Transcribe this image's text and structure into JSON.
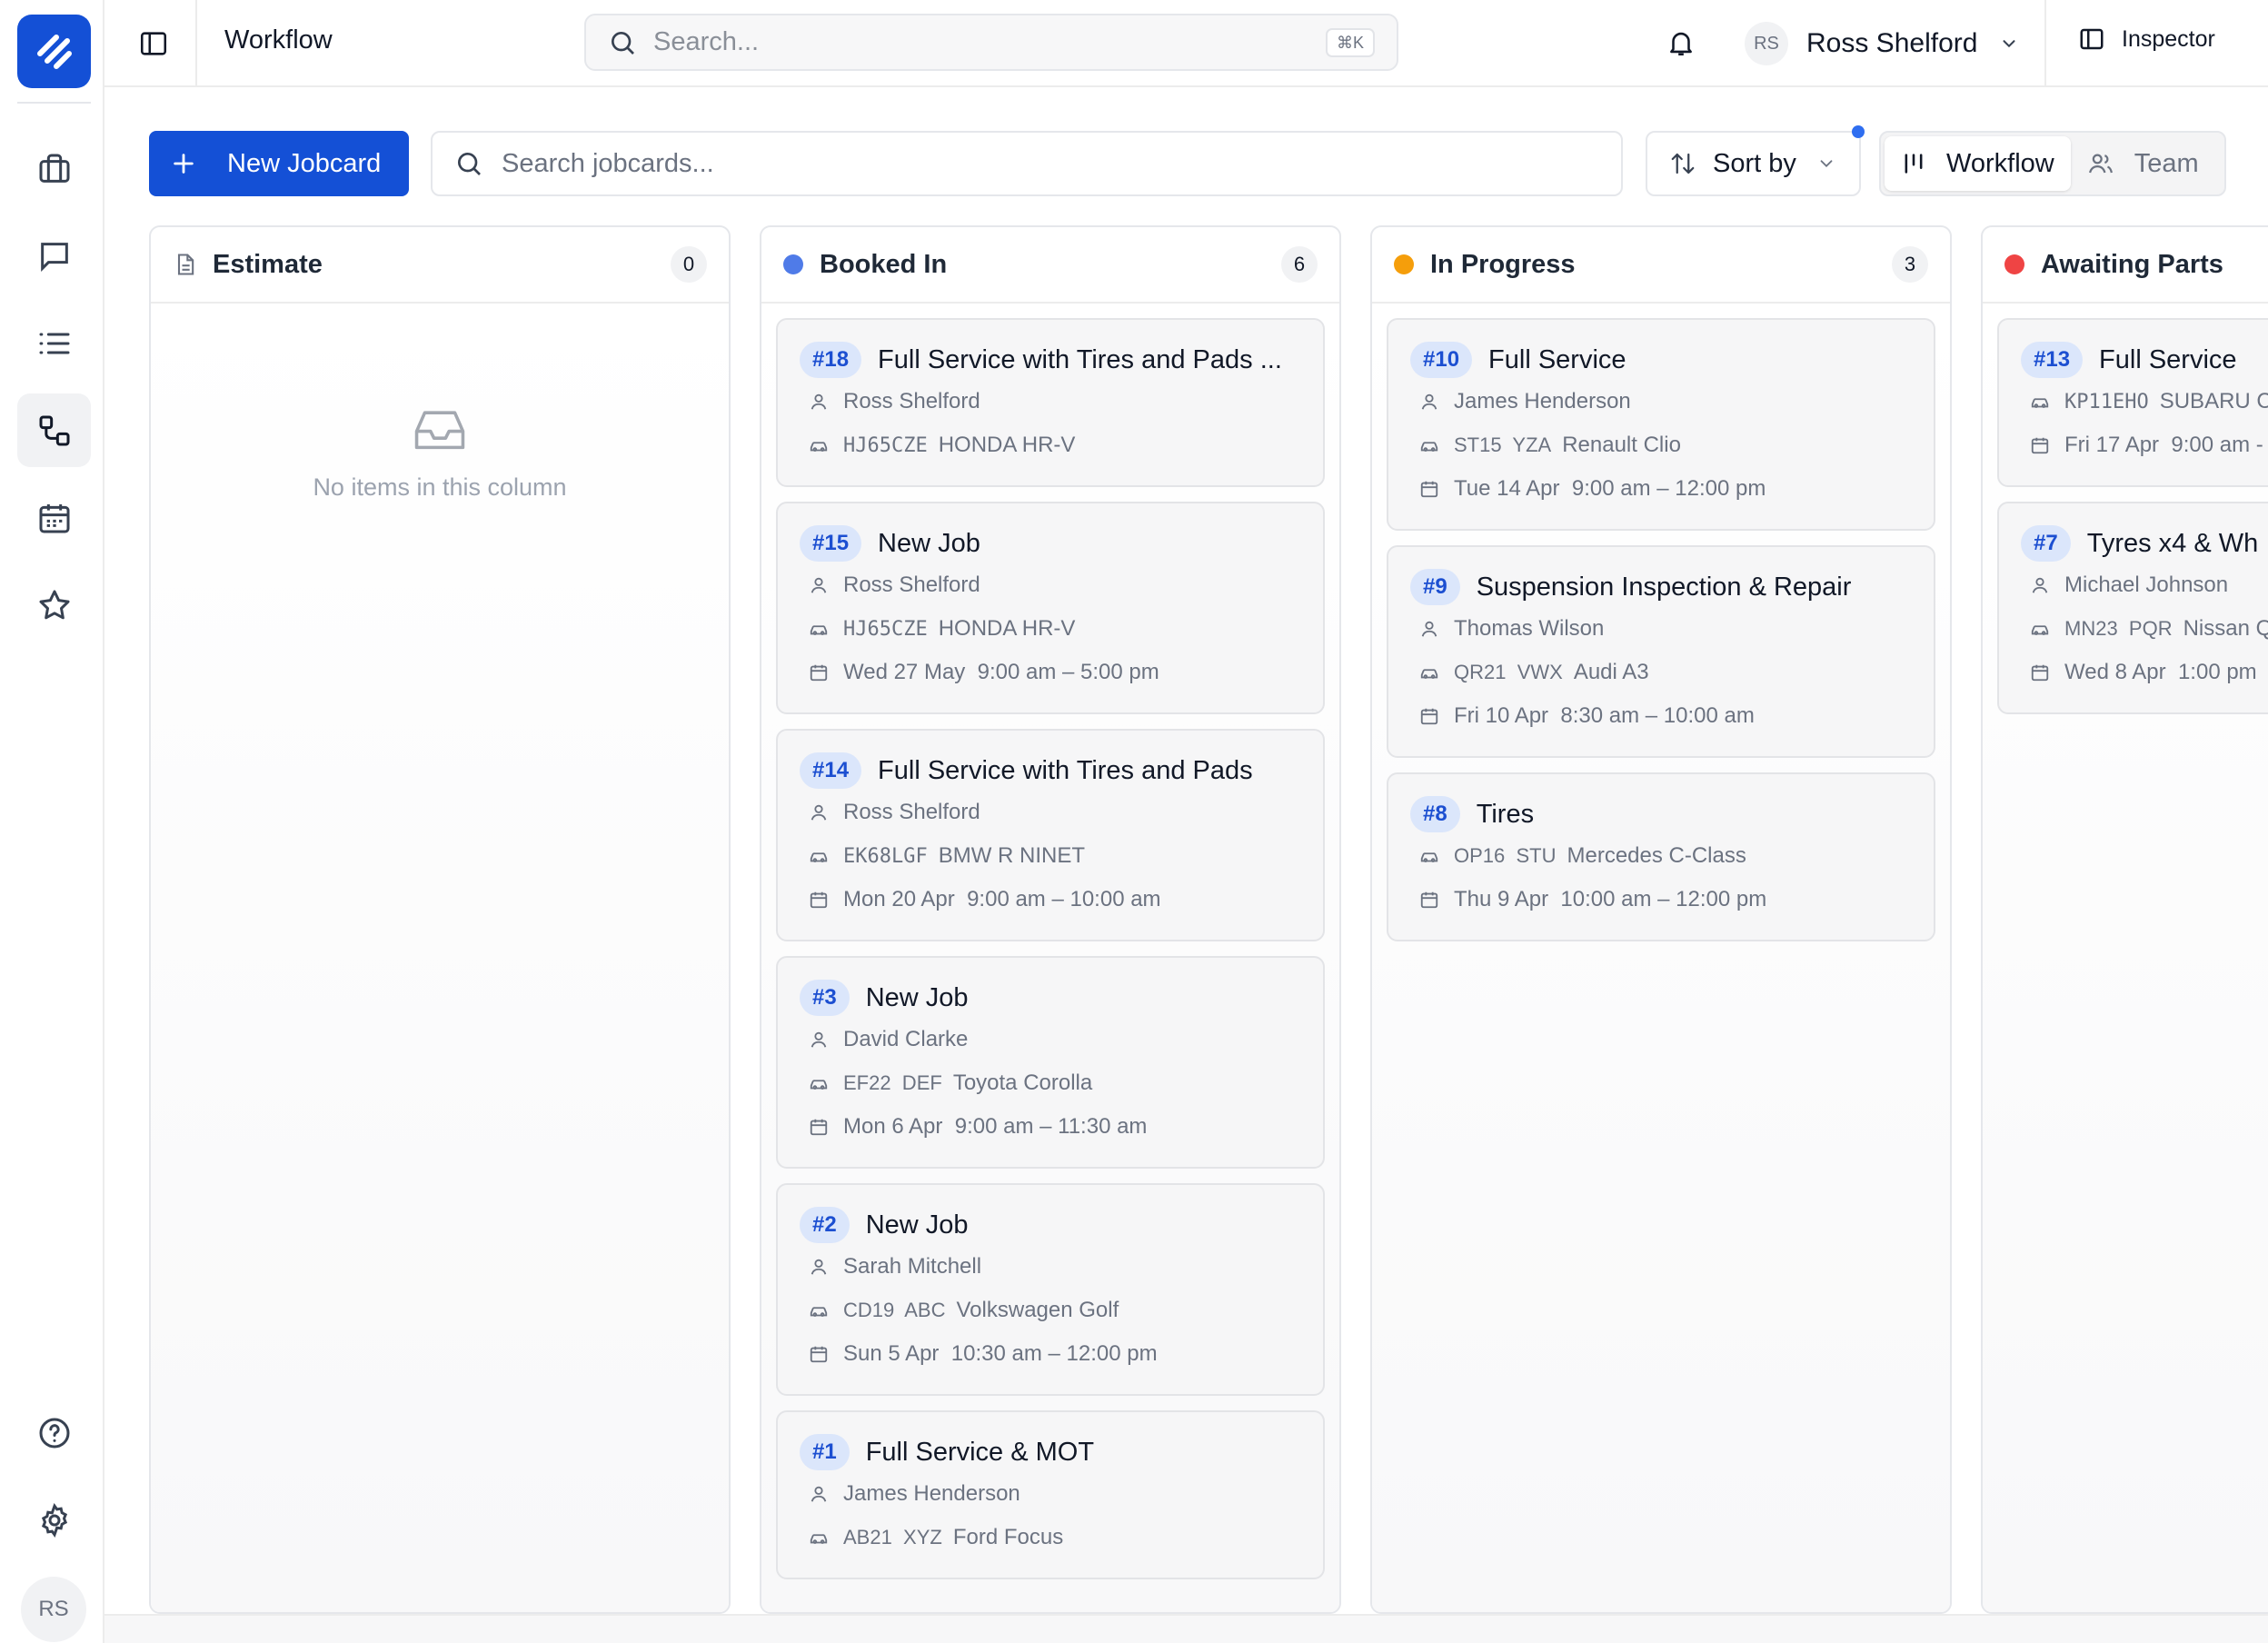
{
  "topbar": {
    "title": "Workflow",
    "search_placeholder": "Search...",
    "shortcut": "⌘K",
    "user_initials": "RS",
    "user_name": "Ross Shelford",
    "inspector_label": "Inspector"
  },
  "rail": {
    "icons": [
      "briefcase-icon",
      "chat-icon",
      "list-icon",
      "workflow-icon",
      "calendar-icon",
      "star-icon"
    ],
    "active": "workflow-icon",
    "bottom_icons": [
      "help-icon",
      "settings-icon"
    ],
    "avatar_initials": "RS"
  },
  "toolbar": {
    "new_label": "New Jobcard",
    "search_placeholder": "Search jobcards...",
    "sort_label": "Sort by",
    "view_workflow": "Workflow",
    "view_team": "Team"
  },
  "colors": {
    "accent": "#1450d6",
    "booked_in": "#4f7be8",
    "in_progress": "#f59e0b",
    "awaiting_parts": "#ef4444"
  },
  "columns": [
    {
      "title": "Estimate",
      "count": "0",
      "empty_message": "No items in this column",
      "cards": []
    },
    {
      "title": "Booked In",
      "count": "6",
      "cards": [
        {
          "id": "#18",
          "title": "Full Service with Tires and Pads ...",
          "customer": "Ross Shelford",
          "reg": "HJ65CZE",
          "vehicle": "HONDA HR-V",
          "date": ""
        },
        {
          "id": "#15",
          "title": "New Job",
          "customer": "Ross Shelford",
          "reg": "HJ65CZE",
          "vehicle": "HONDA HR-V",
          "date": "Wed 27 May  9:00 am – 5:00 pm"
        },
        {
          "id": "#14",
          "title": "Full Service with Tires and Pads",
          "customer": "Ross Shelford",
          "reg": "EK68LGF",
          "vehicle": "BMW R NINET",
          "date": "Mon 20 Apr  9:00 am – 10:00 am"
        },
        {
          "id": "#3",
          "title": "New Job",
          "customer": "David Clarke",
          "reg": "EF22  DEF",
          "vehicle": "Toyota Corolla",
          "date": "Mon 6 Apr  9:00 am – 11:30 am"
        },
        {
          "id": "#2",
          "title": "New Job",
          "customer": "Sarah Mitchell",
          "reg": "CD19  ABC",
          "vehicle": "Volkswagen Golf",
          "date": "Sun 5 Apr  10:30 am – 12:00 pm"
        },
        {
          "id": "#1",
          "title": "Full Service & MOT",
          "customer": "James Henderson",
          "reg": "AB21  XYZ",
          "vehicle": "Ford Focus",
          "date": ""
        }
      ]
    },
    {
      "title": "In Progress",
      "count": "3",
      "cards": [
        {
          "id": "#10",
          "title": "Full Service",
          "customer": "James Henderson",
          "reg": "ST15  YZA",
          "vehicle": "Renault Clio",
          "date": "Tue 14 Apr  9:00 am – 12:00 pm"
        },
        {
          "id": "#9",
          "title": "Suspension Inspection & Repair",
          "customer": "Thomas Wilson",
          "reg": "QR21  VWX",
          "vehicle": "Audi A3",
          "date": "Fri 10 Apr  8:30 am – 10:00 am"
        },
        {
          "id": "#8",
          "title": "Tires",
          "customer": "",
          "reg": "OP16  STU",
          "vehicle": "Mercedes C-Class",
          "date": "Thu 9 Apr  10:00 am – 12:00 pm"
        }
      ]
    },
    {
      "title": "Awaiting Parts",
      "count": "",
      "cards": [
        {
          "id": "#13",
          "title": "Full Service",
          "customer": "",
          "reg": "KP11EHO",
          "vehicle": "SUBARU C",
          "date": "Fri 17 Apr  9:00 am -"
        },
        {
          "id": "#7",
          "title": "Tyres x4 & Wh",
          "customer": "Michael Johnson",
          "reg": "MN23  PQR",
          "vehicle": "Nissan Q",
          "date": "Wed 8 Apr  1:00 pm"
        }
      ]
    }
  ]
}
